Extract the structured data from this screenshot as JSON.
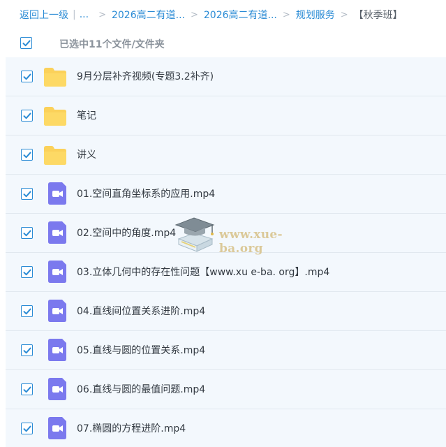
{
  "breadcrumb": {
    "back": "返回上一级",
    "separator": "|",
    "ellipsis": "...",
    "items": [
      "2026高二有道...",
      "2026高二有道...",
      "规划服务"
    ],
    "current": "【秋季班】"
  },
  "selection": {
    "checked": true,
    "text": "已选中11个文件/文件夹"
  },
  "files": [
    {
      "type": "folder",
      "icon": "folder-icon",
      "checked": true,
      "name": "9月分层补齐视频(专题3.2补齐)"
    },
    {
      "type": "folder",
      "icon": "folder-icon",
      "checked": true,
      "name": "笔记"
    },
    {
      "type": "folder",
      "icon": "folder-icon",
      "checked": true,
      "name": "讲义"
    },
    {
      "type": "video",
      "icon": "video-file-icon",
      "checked": true,
      "name": "01.空间直角坐标系的应用.mp4"
    },
    {
      "type": "video",
      "icon": "video-file-icon",
      "checked": true,
      "name": "02.空间中的角度.mp4"
    },
    {
      "type": "video",
      "icon": "video-file-icon",
      "checked": true,
      "name": "03.立体几何中的存在性问题【www.xu e-ba. org】.mp4"
    },
    {
      "type": "video",
      "icon": "video-file-icon",
      "checked": true,
      "name": "04.直线间位置关系进阶.mp4"
    },
    {
      "type": "video",
      "icon": "video-file-icon",
      "checked": true,
      "name": "05.直线与圆的位置关系.mp4"
    },
    {
      "type": "video",
      "icon": "video-file-icon",
      "checked": true,
      "name": "06.直线与圆的最值问题.mp4"
    },
    {
      "type": "video",
      "icon": "video-file-icon",
      "checked": true,
      "name": "07.椭圆的方程进阶.mp4"
    }
  ],
  "watermark": {
    "text": "www.xue-ba.org",
    "icon": "graduation-cap-book-icon"
  },
  "colors": {
    "link": "#2a8bd5",
    "row_background": "#f3f8fd",
    "folder": "#fbd15a",
    "video": "#7b79ee",
    "checkbox": "#2a8bd5"
  }
}
